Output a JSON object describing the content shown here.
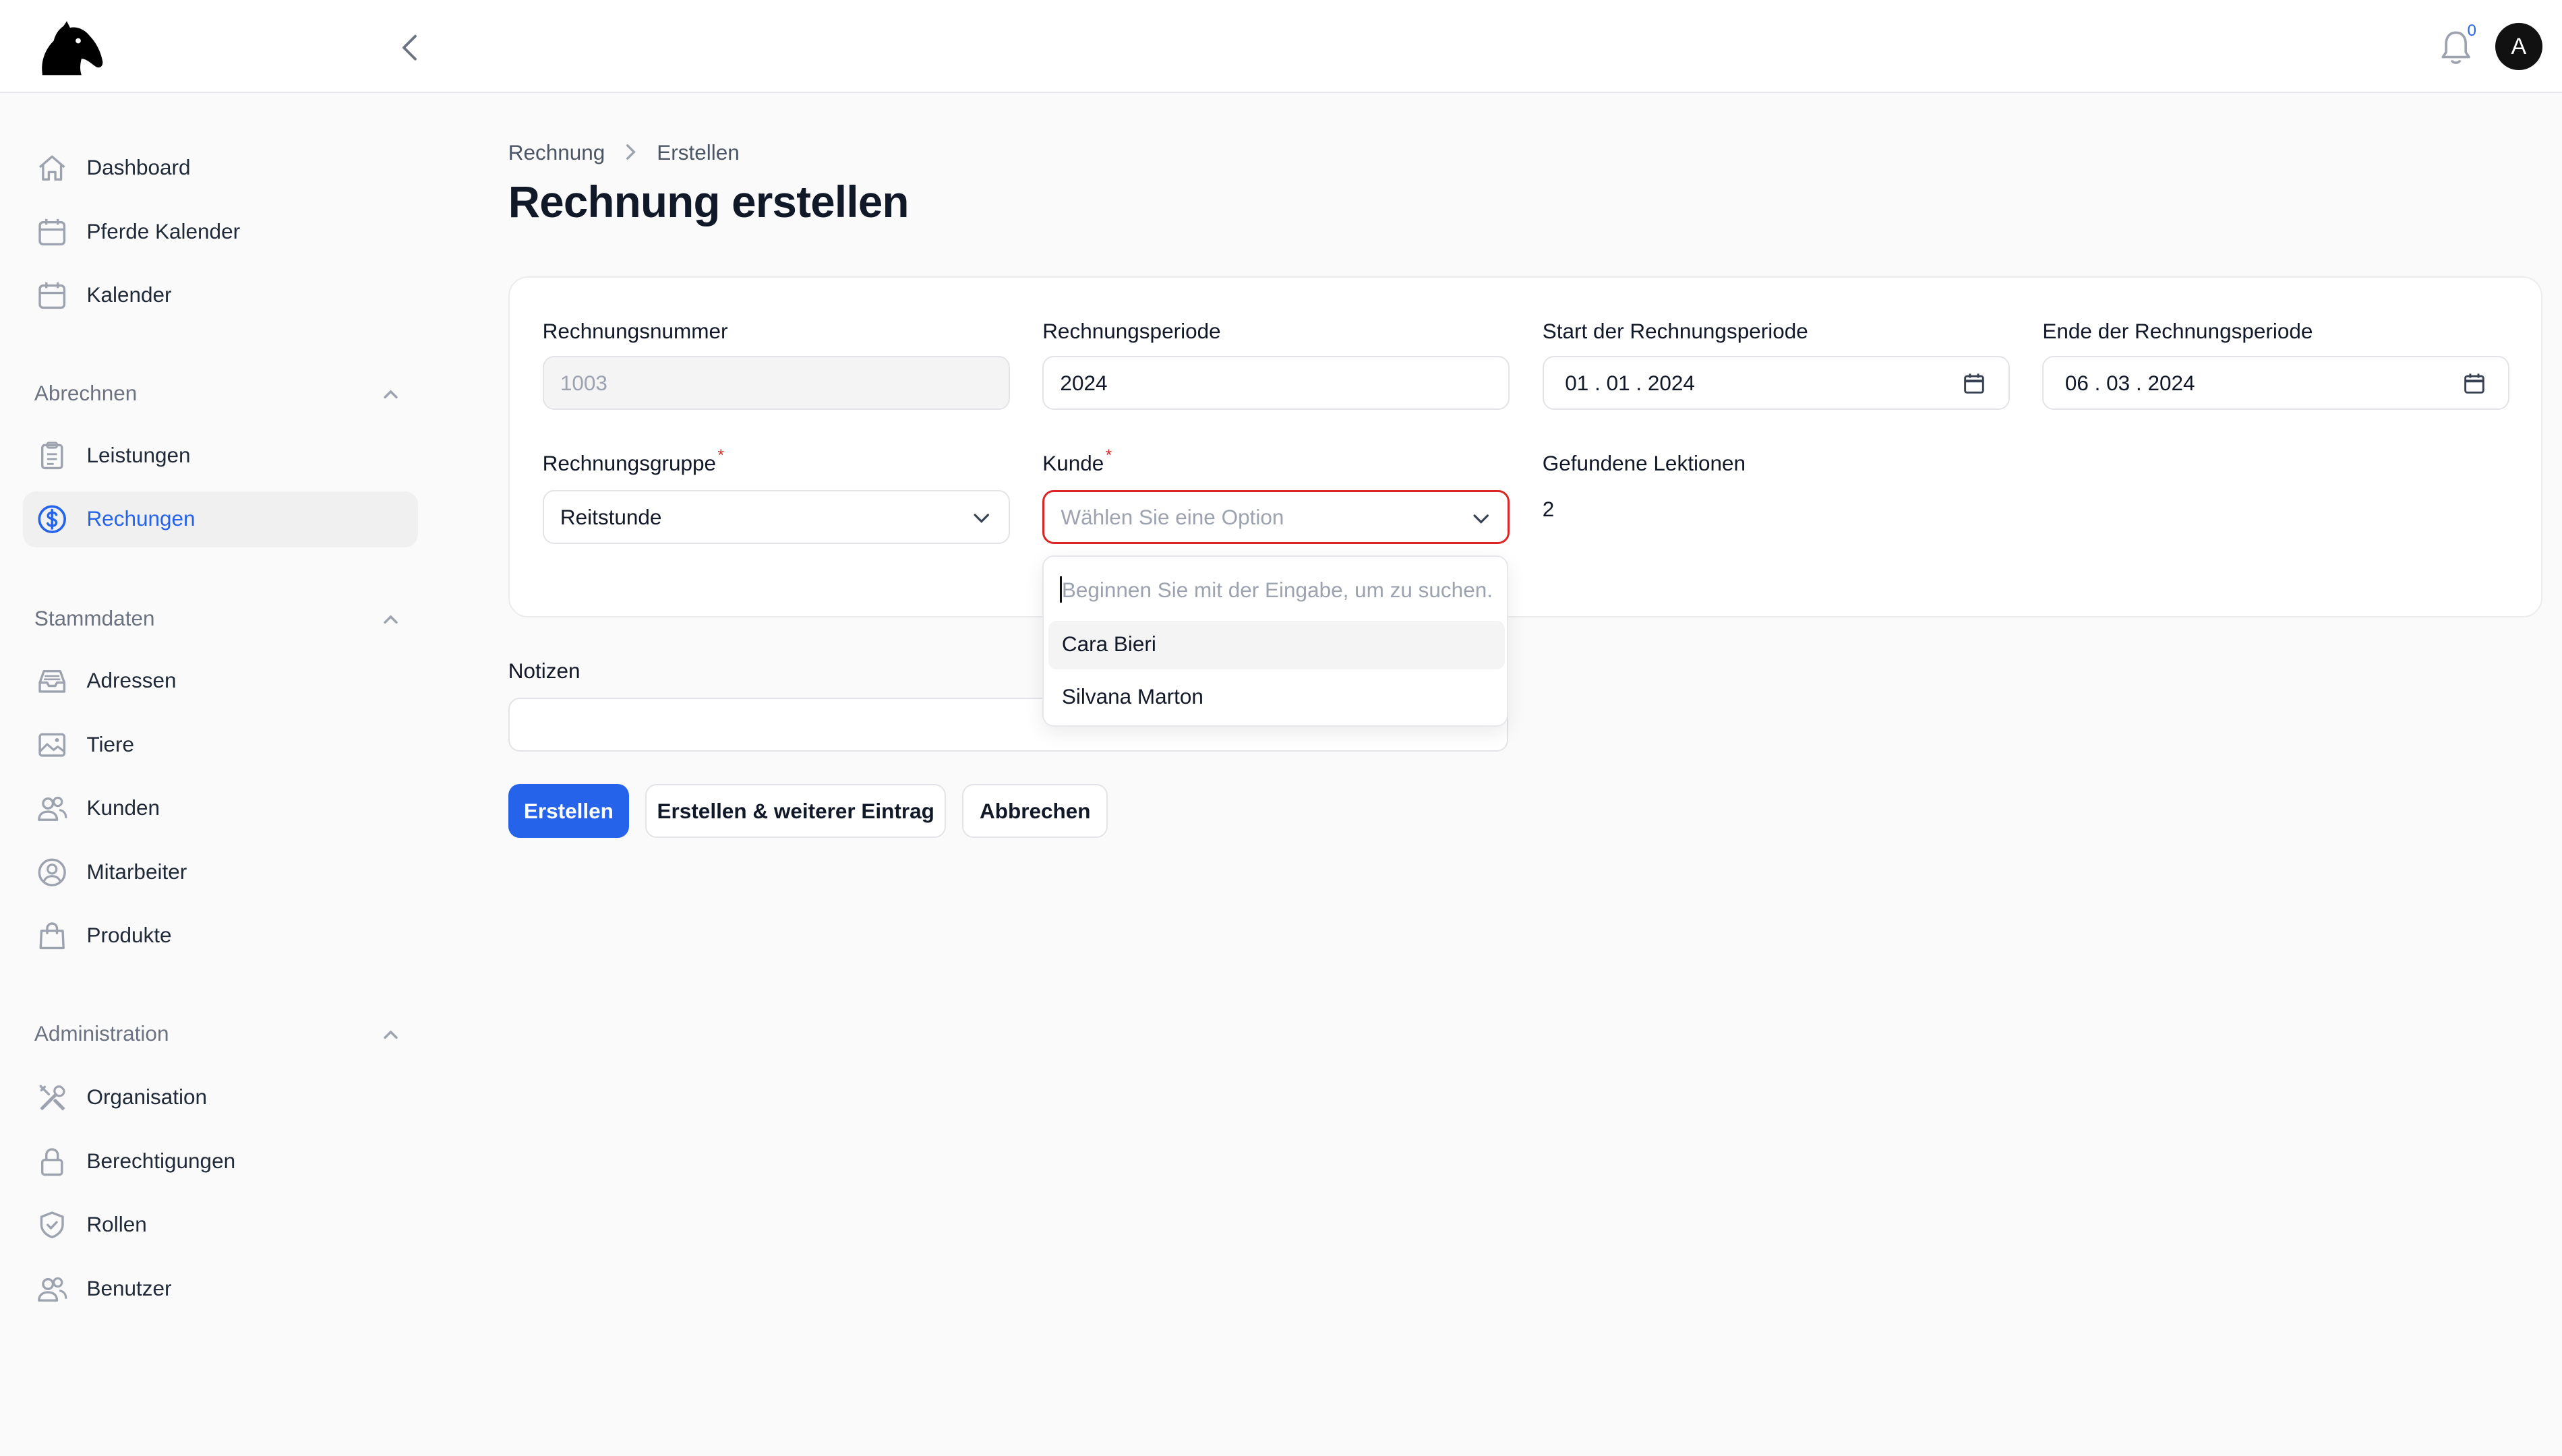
{
  "header": {
    "notification_count": "0",
    "avatar_initial": "A"
  },
  "sidebar": {
    "top_items": [
      {
        "label": "Dashboard",
        "icon": "home-icon"
      },
      {
        "label": "Pferde Kalender",
        "icon": "calendar-icon"
      },
      {
        "label": "Kalender",
        "icon": "calendar-icon"
      }
    ],
    "groups": [
      {
        "label": "Abrechnen",
        "items": [
          {
            "label": "Leistungen",
            "icon": "clipboard-icon"
          },
          {
            "label": "Rechungen",
            "icon": "dollar-circle-icon",
            "active": true
          }
        ]
      },
      {
        "label": "Stammdaten",
        "items": [
          {
            "label": "Adressen",
            "icon": "inbox-icon"
          },
          {
            "label": "Tiere",
            "icon": "image-icon"
          },
          {
            "label": "Kunden",
            "icon": "users-icon"
          },
          {
            "label": "Mitarbeiter",
            "icon": "user-circle-icon"
          },
          {
            "label": "Produkte",
            "icon": "shopping-bag-icon"
          }
        ]
      },
      {
        "label": "Administration",
        "items": [
          {
            "label": "Organisation",
            "icon": "tools-icon"
          },
          {
            "label": "Berechtigungen",
            "icon": "lock-icon"
          },
          {
            "label": "Rollen",
            "icon": "shield-check-icon"
          },
          {
            "label": "Benutzer",
            "icon": "users-icon"
          }
        ]
      }
    ]
  },
  "breadcrumb": {
    "parent": "Rechnung",
    "current": "Erstellen"
  },
  "page_title": "Rechnung erstellen",
  "form": {
    "invoice_number": {
      "label": "Rechnungsnummer",
      "value": "1003"
    },
    "invoice_period": {
      "label": "Rechnungsperiode",
      "value": "2024"
    },
    "period_start": {
      "label": "Start der Rechnungsperiode",
      "value": "01 . 01 . 2024"
    },
    "period_end": {
      "label": "Ende der Rechnungsperiode",
      "value": "06 . 03 . 2024"
    },
    "invoice_group": {
      "label": "Rechnungsgruppe",
      "value": "Reitstunde",
      "required_mark": "*"
    },
    "customer": {
      "label": "Kunde",
      "placeholder": "Wählen Sie eine Option",
      "required_mark": "*"
    },
    "lessons_found": {
      "label": "Gefundene Lektionen",
      "value": "2"
    },
    "notes": {
      "label": "Notizen",
      "value": ""
    }
  },
  "customer_dropdown": {
    "search_placeholder": "Beginnen Sie mit der Eingabe, um zu suchen.",
    "options": [
      "Cara Bieri",
      "Silvana Marton"
    ]
  },
  "actions": {
    "create": "Erstellen",
    "create_another": "Erstellen & weiterer Eintrag",
    "cancel": "Abbrechen"
  },
  "colors": {
    "primary": "#2563eb",
    "error": "#dc2626",
    "active_nav_bg": "#f0f0f1"
  }
}
